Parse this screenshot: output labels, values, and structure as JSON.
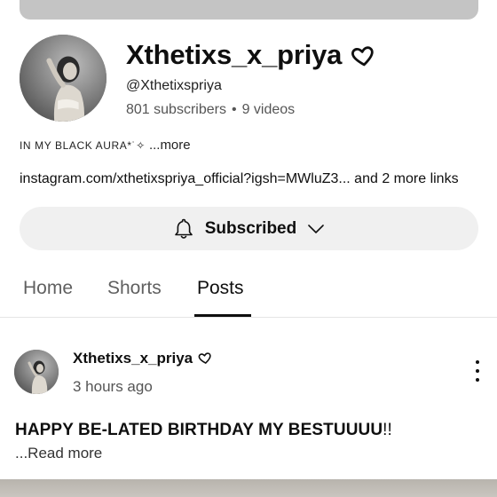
{
  "channel": {
    "name": "Xthetixs_x_priya",
    "handle": "@Xthetixspriya",
    "subscribers": "801 subscribers",
    "separator": "•",
    "videos": "9 videos",
    "bio": "IN MY BLACK AURA*˙✧",
    "bio_more": "...more",
    "links": "instagram.com/xthetixspriya_official?igsh=MWluZ3... and 2 more links",
    "name_icon": "heart-outline-icon"
  },
  "subscribe": {
    "label": "Subscribed",
    "icon": "bell-icon",
    "dropdown_icon": "chevron-down-icon"
  },
  "tabs": [
    {
      "label": "Home",
      "active": false
    },
    {
      "label": "Shorts",
      "active": false
    },
    {
      "label": "Posts",
      "active": true
    }
  ],
  "post": {
    "author": "Xthetixs_x_priya",
    "time": "3 hours ago",
    "text": "HAPPY BE-LATED BIRTHDAY  MY BESTUUUU",
    "text_suffix": "!!",
    "read_more": "...Read more",
    "menu_icon": "more-vert-icon"
  },
  "colors": {
    "banner": "#c4c4c4",
    "button_bg": "#f0f0f0",
    "text": "#0f0f0f",
    "secondary": "#606060"
  }
}
